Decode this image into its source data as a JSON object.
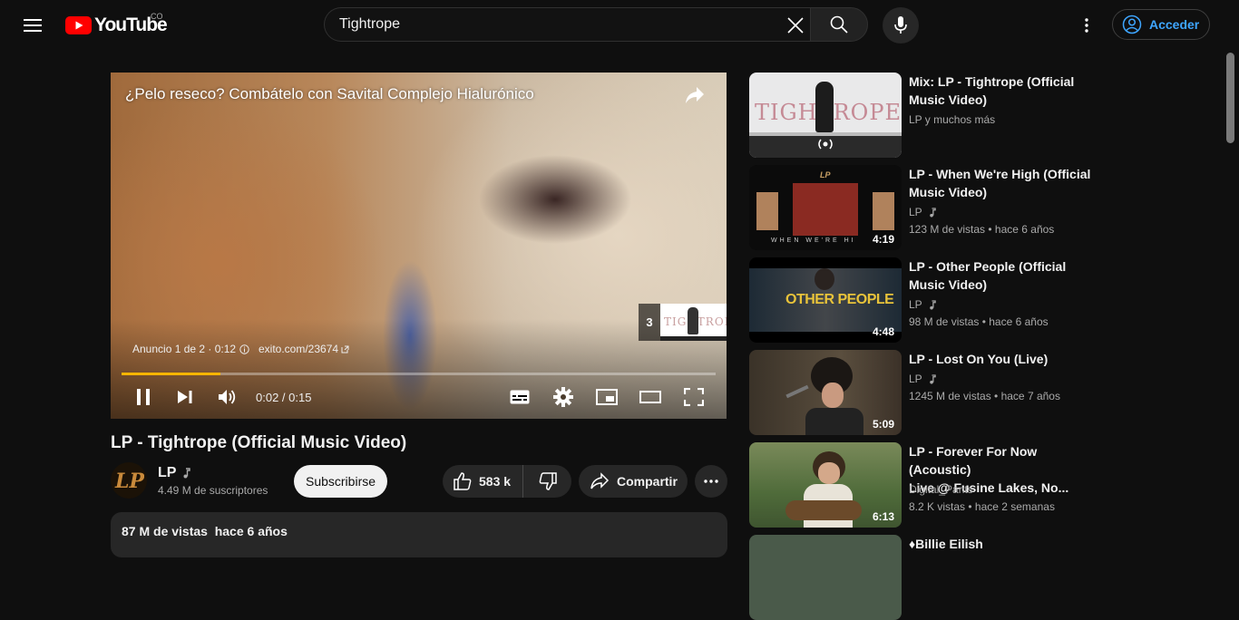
{
  "header": {
    "logo_text": "YouTube",
    "country_code": "CO",
    "search_value": "Tightrope",
    "signin_label": "Acceder"
  },
  "player": {
    "ad_title": "¿Pelo reseco? Combátelo con Savital Complejo Hialurónico",
    "ad_counter": "Anuncio 1 de 2 · 0:12",
    "ad_link": "exito.com/23674",
    "skip_count": "3",
    "time_display": "0:02 / 0:15",
    "progress_fraction": 0.167,
    "progress_color": "#f7b500"
  },
  "video": {
    "title": "LP - Tightrope (Official Music Video)",
    "channel": "LP",
    "subscribers": "4.49 M de suscriptores",
    "subscribe_label": "Subscribirse",
    "likes": "583 k",
    "share_label": "Compartir",
    "views_line": "87 M de vistas  hace 6 años"
  },
  "recommendations": [
    {
      "title_line1": "Mix: LP - Tightrope (Official",
      "title_line2": "Music Video)",
      "channel": "LP y muchos más",
      "meta": "",
      "duration": "",
      "thumb_text": "TIGHTROPE"
    },
    {
      "title_line1": "LP - When We're High (Official",
      "title_line2": "Music Video)",
      "channel": "LP",
      "meta": "123 M de vistas  • hace 6 años",
      "duration": "4:19",
      "thumb_text": "WHEN WE'RE HI"
    },
    {
      "title_line1": "LP - Other People (Official",
      "title_line2": "Music Video)",
      "channel": "LP",
      "meta": "98 M de vistas  • hace 6 años",
      "duration": "4:48",
      "thumb_text": "OTHER PEOPLE"
    },
    {
      "title_line1": "LP - Lost On You (Live)",
      "title_line2": "",
      "channel": "LP",
      "meta": "1245 M de vistas  • hace 7 años",
      "duration": "5:09",
      "thumb_text": ""
    },
    {
      "title_line1": "LP - Forever For Now (Acoustic)",
      "title_line2": "Live @ Fusine Lakes, No...",
      "channel": "Digital_Pants",
      "meta": "8.2 K vistas  • hace 2 semanas",
      "duration": "6:13",
      "thumb_text": ""
    },
    {
      "title_line1": "♦Billie Eilish",
      "title_line2": "",
      "channel": "",
      "meta": "",
      "duration": "",
      "thumb_text": ""
    }
  ]
}
